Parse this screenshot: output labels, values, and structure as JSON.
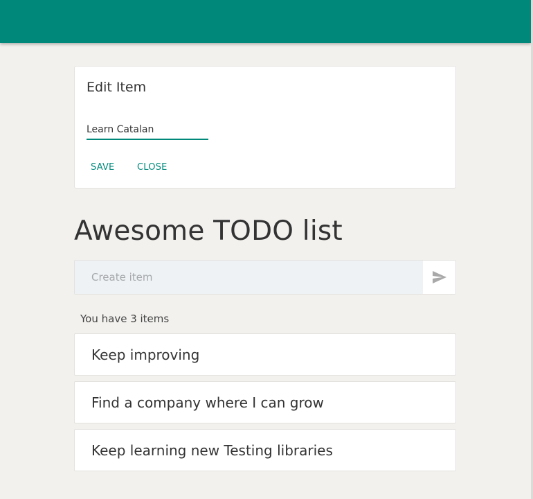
{
  "edit_card": {
    "title": "Edit Item",
    "input_value": "Learn Catalan",
    "save_label": "SAVE",
    "close_label": "CLOSE"
  },
  "main": {
    "heading": "Awesome TODO list",
    "create_placeholder": "Create item",
    "send_icon": "send-icon",
    "count_text": "You have 3 items"
  },
  "todos": [
    {
      "label": "Keep improving"
    },
    {
      "label": "Find a company where I can grow"
    },
    {
      "label": "Keep learning new Testing libraries"
    }
  ],
  "colors": {
    "accent": "#00897b",
    "background": "#f2f1ee",
    "input_background": "#eef2f5"
  }
}
